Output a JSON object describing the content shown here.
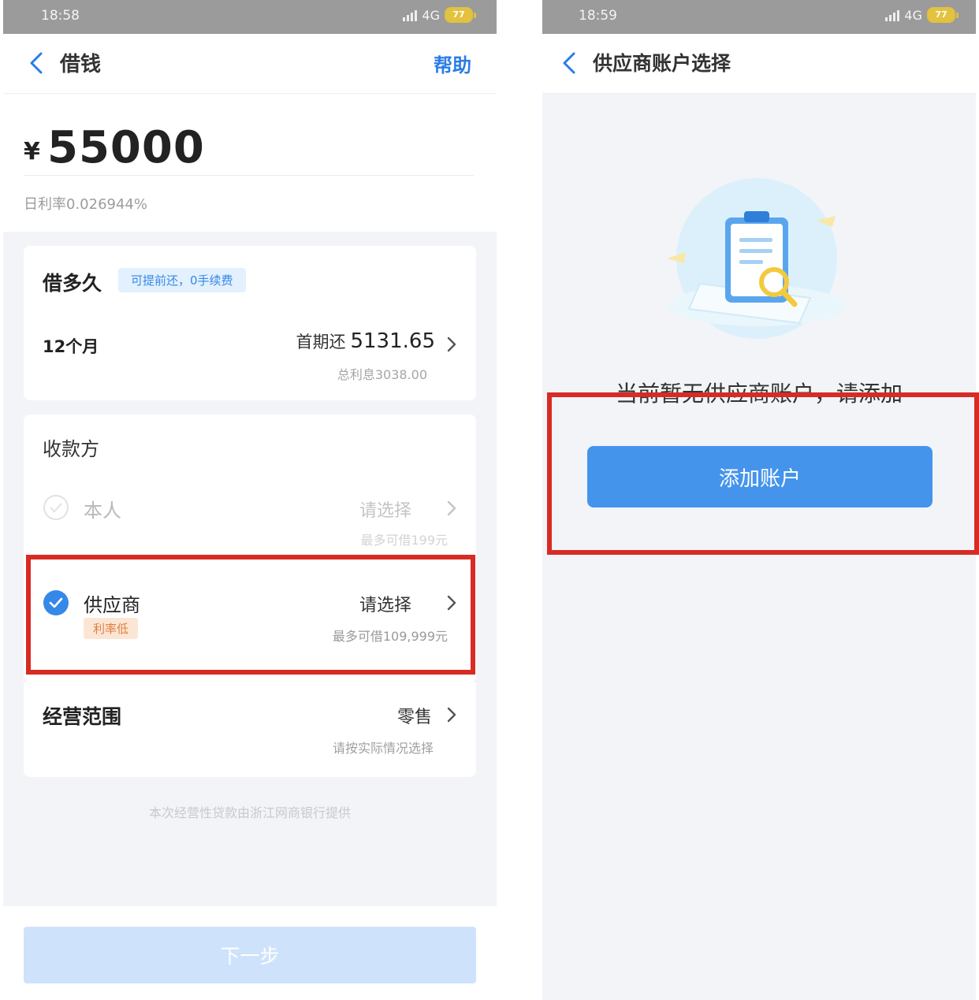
{
  "left_screen": {
    "status_bar": {
      "time": "18:58",
      "network": "4G",
      "battery": "77"
    },
    "nav": {
      "title": "借钱",
      "help": "帮助"
    },
    "amount": {
      "currency": "¥",
      "value": "55000",
      "daily_rate": "日利率0.026944%"
    },
    "term": {
      "title": "借多久",
      "badge": "可提前还，0手续费",
      "value": "12个月",
      "first_label": "首期还",
      "first_value": "5131.65",
      "total_interest": "总利息3038.00"
    },
    "payee": {
      "title": "收款方",
      "self": {
        "label": "本人",
        "select": "请选择",
        "max": "最多可借199元"
      },
      "supplier": {
        "label": "供应商",
        "tag": "利率低",
        "select": "请选择",
        "max": "最多可借109,999元"
      }
    },
    "scope": {
      "title": "经营范围",
      "value": "零售",
      "hint": "请按实际情况选择"
    },
    "provider_note": "本次经营性贷款由浙江网商银行提供",
    "next_button": "下一步"
  },
  "right_screen": {
    "status_bar": {
      "time": "18:59",
      "network": "4G",
      "battery": "77"
    },
    "nav": {
      "title": "供应商账户选择"
    },
    "empty_text": "当前暂无供应商账户，请添加",
    "add_button": "添加账户"
  },
  "colors": {
    "accent_blue": "#2a7ce6",
    "button_blue": "#4594ec",
    "disabled_button": "#cfe2fb",
    "highlight_red": "#d72b24",
    "rate_tag": "#e17e3e"
  },
  "icons": [
    "back-chevron-icon",
    "chevron-right-icon",
    "check-circle-icon",
    "signal-icon",
    "battery-icon",
    "clipboard-search-icon"
  ]
}
